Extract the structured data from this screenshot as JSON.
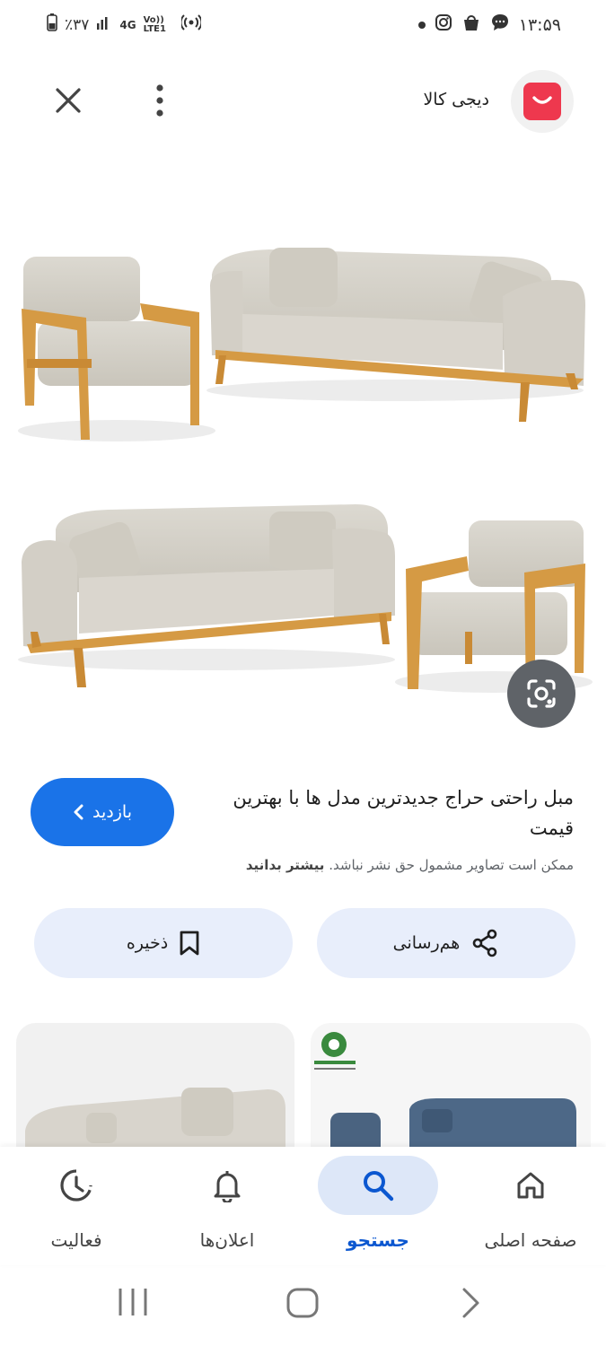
{
  "status_bar": {
    "battery": "٪۳۷",
    "network": "4G",
    "volte": "Vo)) LTE1",
    "time": "۱۳:۵۹"
  },
  "header": {
    "site_name": "دیجی کالا",
    "icons": [
      "close-icon",
      "more-vert-icon",
      "digikala-logo"
    ]
  },
  "result": {
    "title": "مبل راحتی حراج جدیدترین مدل ها با بهترین قیمت",
    "visit_label": "بازدید",
    "copyright_text": "ممکن است تصاویر مشمول حق نشر نباشد.",
    "learn_more": "بیشتر بدانید"
  },
  "actions": {
    "share_label": "هم‌رسانی",
    "save_label": "ذخیره"
  },
  "bottom_nav": {
    "items": [
      {
        "label": "صفحه اصلی",
        "icon": "home-icon"
      },
      {
        "label": "جستجو",
        "icon": "search-icon",
        "active": true
      },
      {
        "label": "اعلان‌ها",
        "icon": "bell-icon"
      },
      {
        "label": "فعالیت",
        "icon": "history-icon"
      }
    ]
  },
  "colors": {
    "accent": "#1a73e8",
    "action_bg": "#e8eefb",
    "active_nav": "#0b57d0",
    "brand": "#ee384e"
  }
}
